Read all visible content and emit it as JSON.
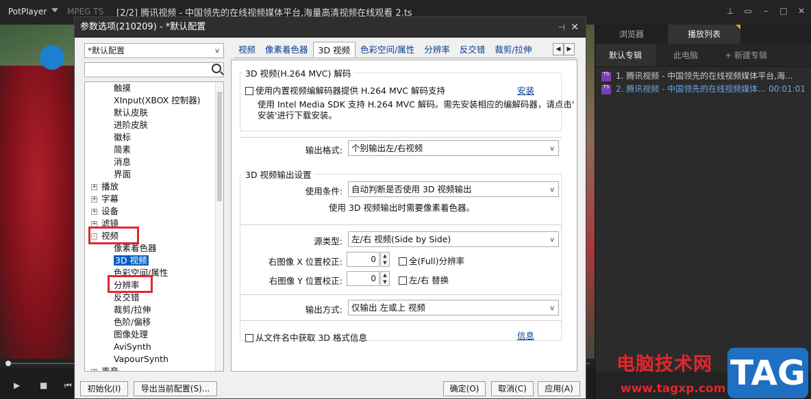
{
  "app": {
    "brand": "PotPlayer",
    "format": "MPEG TS",
    "title": "[2/2] 腾讯视频 - 中国领先的在线视频媒体平台,海量高清视频在线观看 2.ts"
  },
  "playlist": {
    "tabs": [
      "浏览器",
      "播放列表"
    ],
    "subtabs": [
      "默认专辑",
      "此电脑",
      "+ 新建专辑"
    ],
    "items": [
      {
        "icon": "TS",
        "label": "1. 腾讯视频 - 中国领先的在线视频媒体平台,海...",
        "duration": ""
      },
      {
        "icon": "TS",
        "label": "2. 腾讯视频 - 中国领先的在线视频媒体...",
        "duration": "00:01:01"
      }
    ]
  },
  "watermark": {
    "cn": "电脑技术网",
    "url": "www.tagxp.com",
    "tag": "TAG"
  },
  "dialog": {
    "title": "参数选项(210209) - *默认配置",
    "preset": "*默认配置",
    "search_placeholder": "",
    "tree": [
      {
        "label": "触摸",
        "level": 2
      },
      {
        "label": "XInput(XBOX 控制器)",
        "level": 2
      },
      {
        "label": "默认皮肤",
        "level": 2
      },
      {
        "label": "进阶皮肤",
        "level": 2
      },
      {
        "label": "徽标",
        "level": 2
      },
      {
        "label": "简素",
        "level": 2
      },
      {
        "label": "消息",
        "level": 2
      },
      {
        "label": "界面",
        "level": 2
      },
      {
        "label": "播放",
        "level": 1,
        "expander": "+"
      },
      {
        "label": "字幕",
        "level": 1,
        "expander": "+"
      },
      {
        "label": "设备",
        "level": 1,
        "expander": "+"
      },
      {
        "label": "滤镜",
        "level": 1,
        "expander": "+"
      },
      {
        "label": "视频",
        "level": 1,
        "expander": "−"
      },
      {
        "label": "像素着色器",
        "level": 2
      },
      {
        "label": "3D 视频",
        "level": 2,
        "selected": true
      },
      {
        "label": "色彩空间/属性",
        "level": 2
      },
      {
        "label": "分辨率",
        "level": 2
      },
      {
        "label": "反交错",
        "level": 2
      },
      {
        "label": "裁剪/拉伸",
        "level": 2
      },
      {
        "label": "色阶/偏移",
        "level": 2
      },
      {
        "label": "图像处理",
        "level": 2
      },
      {
        "label": "AviSynth",
        "level": 2
      },
      {
        "label": "VapourSynth",
        "level": 2
      },
      {
        "label": "声音",
        "level": 1,
        "expander": "+"
      }
    ],
    "tabs": [
      "视频",
      "像素着色器",
      "3D 视频",
      "色彩空间/属性",
      "分辨率",
      "反交错",
      "裁剪/拉伸"
    ],
    "active_tab": "3D 视频",
    "mvc": {
      "group_label": "3D 视频(H.264 MVC) 解码",
      "checkbox_label": "使用内置视频编解码器提供 H.264 MVC 解码支持",
      "install_link": "安装",
      "desc_line1": "使用 Intel Media SDK 支持 H.264 MVC 解码。需先安装相应的编解码器，请点击'",
      "desc_line2": "安装'进行下载安装。",
      "output_format_label": "输出格式:",
      "output_format_value": "个别输出左/右视频"
    },
    "output3d": {
      "group_label": "3D 视频输出设置",
      "condition_label": "使用条件:",
      "condition_value": "自动判断是否使用 3D 视频输出",
      "note": "使用 3D 视频输出时需要像素着色器。",
      "source_type_label": "源类型:",
      "source_type_value": "左/右 视频(Side by Side)",
      "x_label": "右图像 X 位置校正:",
      "x_value": "0",
      "fullres_label": "全(Full)分辨率",
      "y_label": "右图像 Y 位置校正:",
      "y_value": "0",
      "swap_label": "左/右 替换",
      "output_mode_label": "输出方式:",
      "output_mode_value": "仅输出 左或上 视频",
      "filename_label": "从文件名中获取 3D 格式信息",
      "info_link": "信息"
    },
    "buttons": {
      "init": "初始化(I)",
      "export": "导出当前配置(S)...",
      "ok": "确定(O)",
      "cancel": "取消(C)",
      "apply": "应用(A)"
    }
  }
}
